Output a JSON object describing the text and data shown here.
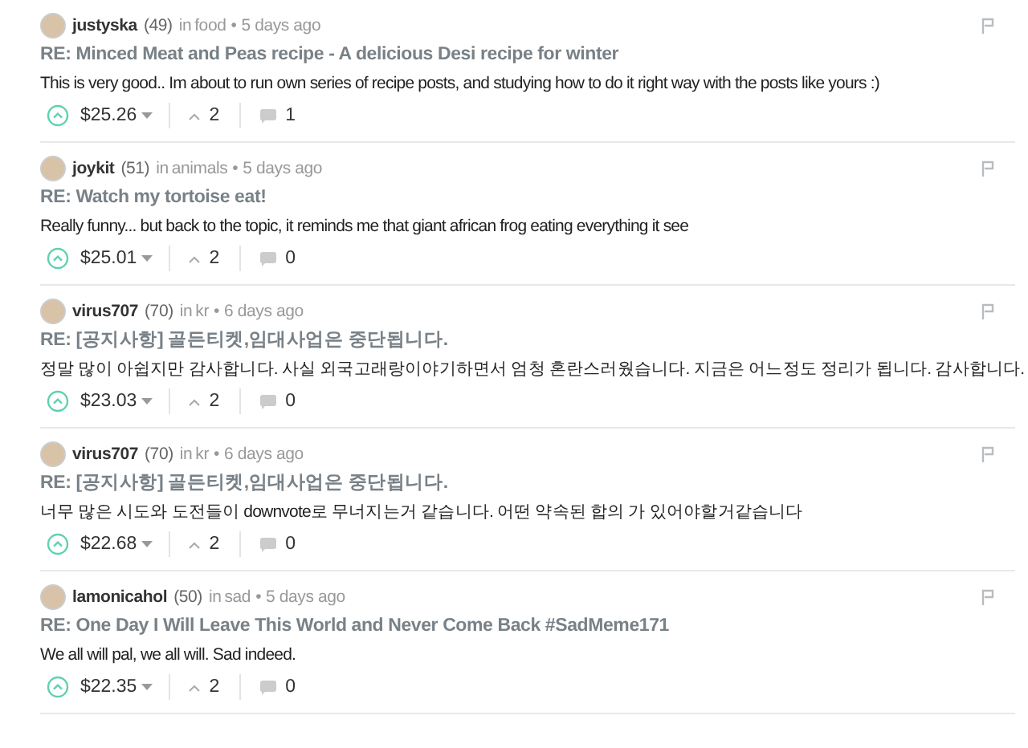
{
  "comments": [
    {
      "author": "justyska",
      "reputation": "(49)",
      "community_prefix": "in",
      "separator": "•",
      "community": "food",
      "age": "5 days ago",
      "title": "RE: Minced Meat and Peas recipe - A delicious Desi recipe for winter",
      "body": "This is very good.. Im about to run own series of recipe posts, and studying how to do it right way with the posts like yours :)",
      "payout": "$25.26",
      "votes": "2",
      "replies": "1"
    },
    {
      "author": "joykit",
      "reputation": "(51)",
      "community_prefix": "in",
      "separator": "•",
      "community": "animals",
      "age": "5 days ago",
      "title": "RE: Watch my tortoise eat!",
      "body": "Really funny... but back to the topic, it reminds me that giant african frog eating everything it see",
      "payout": "$25.01",
      "votes": "2",
      "replies": "0"
    },
    {
      "author": "virus707",
      "reputation": "(70)",
      "community_prefix": "in",
      "separator": "•",
      "community": "kr",
      "age": "6 days ago",
      "title": "RE: [공지사항] 골든티켓,임대사업은 중단됩니다.",
      "body": "정말 많이 아쉽지만 감사합니다. 사실 외국고래랑이야기하면서 엄청 혼란스러웠습니다. 지금은 어느정도 정리가 됩니다. 감사합니다.",
      "payout": "$23.03",
      "votes": "2",
      "replies": "0"
    },
    {
      "author": "virus707",
      "reputation": "(70)",
      "community_prefix": "in",
      "separator": "•",
      "community": "kr",
      "age": "6 days ago",
      "title": "RE: [공지사항] 골든티켓,임대사업은 중단됩니다.",
      "body": "너무 많은 시도와 도전들이 downvote로 무너지는거 같습니다. 어떤 약속된 합의 가 있어야할거같습니다",
      "payout": "$22.68",
      "votes": "2",
      "replies": "0"
    },
    {
      "author": "lamonicahol",
      "reputation": "(50)",
      "community_prefix": "in",
      "separator": "•",
      "community": "sad",
      "age": "5 days ago",
      "title": "RE: One Day I Will Leave This World and Never Come Back #SadMeme171",
      "body": "We all will pal, we all will. Sad indeed.",
      "payout": "$22.35",
      "votes": "2",
      "replies": "0"
    }
  ]
}
